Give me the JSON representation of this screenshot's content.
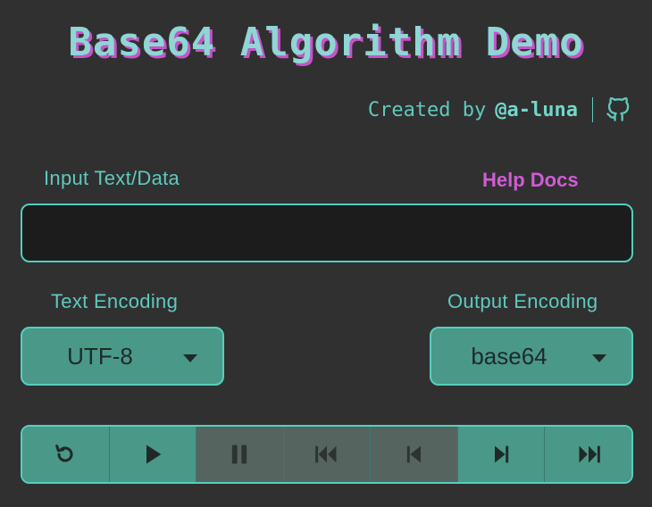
{
  "header": {
    "title": "Base64 Algorithm Demo",
    "created_by": "Created by",
    "author": "@a-luna"
  },
  "input": {
    "label": "Input Text/Data",
    "value": "",
    "help_link": "Help Docs"
  },
  "encodings": {
    "text_label": "Text Encoding",
    "text_value": "UTF-8",
    "output_label": "Output Encoding",
    "output_value": "base64"
  },
  "controls": [
    {
      "name": "reset",
      "icon": "reset-icon",
      "enabled": true
    },
    {
      "name": "play",
      "icon": "play-icon",
      "enabled": true
    },
    {
      "name": "pause",
      "icon": "pause-icon",
      "enabled": false
    },
    {
      "name": "go-to-first",
      "icon": "skip-back-icon",
      "enabled": false
    },
    {
      "name": "step-back",
      "icon": "step-back-icon",
      "enabled": false
    },
    {
      "name": "step-forward",
      "icon": "step-forward-icon",
      "enabled": true
    },
    {
      "name": "go-to-last",
      "icon": "skip-forward-icon",
      "enabled": true
    }
  ],
  "colors": {
    "background": "#303030",
    "accent": "#54d0bd",
    "title_shadow": "#c653c9",
    "link": "#d25bd6",
    "button_fill": "#4a9888",
    "button_disabled": "#56645f"
  }
}
